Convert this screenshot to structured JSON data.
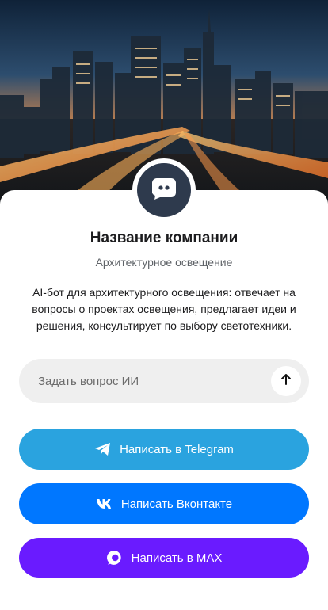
{
  "company": {
    "name": "Название компании",
    "category": "Архитектурное освещение",
    "description": "AI-бот для архитектурного освещения: отвечает на вопросы о проектах освещения, предлагает идеи и решения, консультирует по выбору светотехники.",
    "avatar_icon": "chat-bot-icon"
  },
  "ask": {
    "placeholder": "Задать вопрос ИИ",
    "send_icon": "arrow-up-icon"
  },
  "buttons": {
    "telegram": {
      "label": "Написать в Telegram",
      "icon": "telegram-icon",
      "color": "#2aa3df"
    },
    "vk": {
      "label": "Написать Вконтакте",
      "icon": "vk-icon",
      "color": "#0077ff"
    },
    "max": {
      "label": "Написать в MAX",
      "icon": "max-icon",
      "color": "#6a1bff"
    }
  },
  "colors": {
    "avatar_bg": "#2e3a4d",
    "ask_bg": "#efefef"
  }
}
